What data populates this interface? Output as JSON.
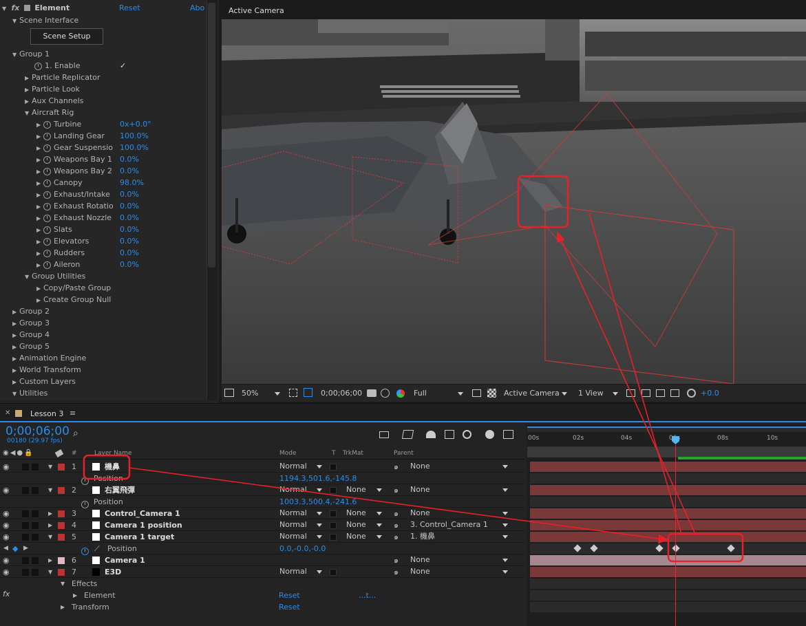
{
  "effect_panel": {
    "title": "Element",
    "reset": "Reset",
    "about": "Abo",
    "scene_interface": "Scene Interface",
    "scene_setup": "Scene Setup",
    "group1": "Group 1",
    "enable": "1. Enable",
    "enable_check": "✓",
    "particle_replicator": "Particle Replicator",
    "particle_look": "Particle Look",
    "aux_channels": "Aux Channels",
    "aircraft_rig": "Aircraft Rig",
    "rig": [
      {
        "label": "Turbine",
        "value": "0x+0.0°"
      },
      {
        "label": "Landing Gear",
        "value": "100.0%"
      },
      {
        "label": "Gear Suspensio",
        "value": "100.0%"
      },
      {
        "label": "Weapons Bay 1",
        "value": "0.0%"
      },
      {
        "label": "Weapons Bay 2",
        "value": "0.0%"
      },
      {
        "label": "Canopy",
        "value": "98.0%"
      },
      {
        "label": "Exhaust/Intake",
        "value": "0.0%"
      },
      {
        "label": "Exhaust Rotatio",
        "value": "0.0%"
      },
      {
        "label": "Exhaust Nozzle",
        "value": "0.0%"
      },
      {
        "label": "Slats",
        "value": "0.0%"
      },
      {
        "label": "Elevators",
        "value": "0.0%"
      },
      {
        "label": "Rudders",
        "value": "0.0%"
      },
      {
        "label": "Aileron",
        "value": "0.0%"
      }
    ],
    "group_utilities": "Group Utilities",
    "copy_paste": "Copy/Paste Group",
    "create_null": "Create Group Null",
    "groups": [
      "Group 2",
      "Group 3",
      "Group 4",
      "Group 5",
      "Animation Engine",
      "World Transform",
      "Custom Layers"
    ],
    "utilities": "Utilities"
  },
  "viewer": {
    "title": "Active Camera",
    "zoom": "50%",
    "timecode": "0;00;06;00",
    "resolution": "Full",
    "camera": "Active Camera",
    "views": "1 View",
    "exposure": "+0.0"
  },
  "timeline": {
    "tab": "Lesson 3",
    "timecode": "0;00;06;00",
    "frames": "00180 (29.97 fps)",
    "search_icon": "⌕",
    "col_layer": "Layer Name",
    "col_mode": "Mode",
    "col_t": "T",
    "col_trkmat": "TrkMat",
    "col_parent": "Parent",
    "col_hash": "#",
    "ruler": [
      "00s",
      "02s",
      "04s",
      "06s",
      "08s",
      "10s"
    ],
    "layers": [
      {
        "num": "1",
        "name": "機鼻",
        "mode": "Normal",
        "trkmat": "",
        "parent": "None"
      },
      {
        "num": "2",
        "name": "右翼飛彈",
        "mode": "Normal",
        "trkmat": "None",
        "parent": "None"
      },
      {
        "num": "3",
        "name": "Control_Camera 1",
        "mode": "Normal",
        "trkmat": "None",
        "parent": "None"
      },
      {
        "num": "4",
        "name": "Camera 1 position",
        "mode": "Normal",
        "trkmat": "None",
        "parent": "3. Control_Camera 1"
      },
      {
        "num": "5",
        "name": "Camera 1 target",
        "mode": "Normal",
        "trkmat": "None",
        "parent": "1. 機鼻"
      },
      {
        "num": "6",
        "name": "Camera 1",
        "mode": "",
        "trkmat": "",
        "parent": "None"
      },
      {
        "num": "7",
        "name": "E3D",
        "mode": "Normal",
        "trkmat": "",
        "parent": "None"
      }
    ],
    "pos1_label": "Position",
    "pos1_value": "1194.3,501.6,-145.8",
    "pos2_label": "Position",
    "pos2_value": "1003.3,500.4,-241.6",
    "pos5_label": "Position",
    "pos5_value": "0.0,-0.0,-0.0",
    "effects": "Effects",
    "element": "Element",
    "element_reset": "Reset",
    "element_about": "...t...",
    "transform": "Transform",
    "transform_reset": "Reset",
    "fx": "fx"
  }
}
